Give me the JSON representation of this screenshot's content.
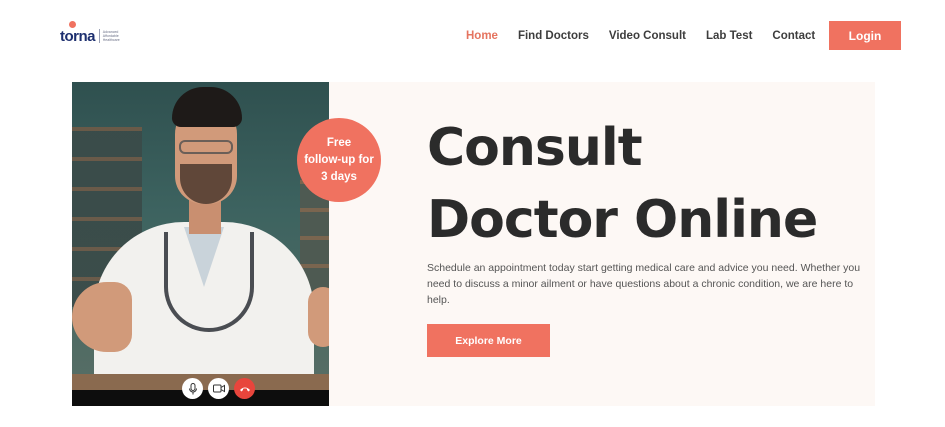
{
  "brand": {
    "logo_text": "torna",
    "logo_tagline": [
      "Advanced",
      "Affordable",
      "Healthcare"
    ]
  },
  "nav": {
    "items": [
      {
        "label": "Home",
        "active": true
      },
      {
        "label": "Find Doctors",
        "active": false
      },
      {
        "label": "Video Consult",
        "active": false
      },
      {
        "label": "Lab Test",
        "active": false
      },
      {
        "label": "Contact",
        "active": false
      }
    ],
    "login_label": "Login"
  },
  "hero": {
    "badge": [
      "Free",
      "follow-up for",
      "3 days"
    ],
    "title_line1": "Consult",
    "title_line2_highlight": "Doctor",
    "title_line2_rest": " Online",
    "description": "Schedule an appointment today start getting medical care and advice you need. Whether you need to discuss a minor ailment or have questions about a chronic condition, we are here to help.",
    "cta_label": "Explore More",
    "call_controls": [
      "microphone-icon",
      "video-camera-icon",
      "end-call-icon"
    ]
  },
  "colors": {
    "accent": "#f07260",
    "text": "#2b2b2b",
    "hero_bg": "#fdf8f5",
    "highlight": "#f5b7ad",
    "end_call": "#e8453c"
  }
}
